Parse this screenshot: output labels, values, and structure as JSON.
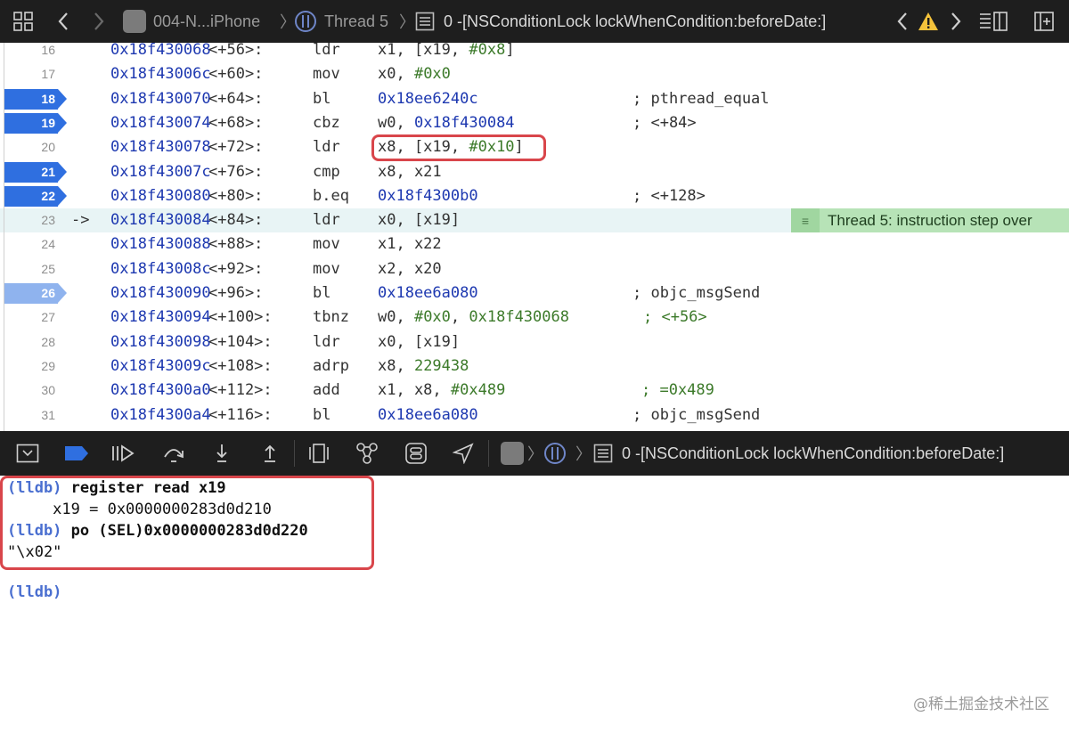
{
  "jump_bar": {
    "grid_icon": "grid-icon",
    "back": "chevron-left-icon",
    "forward": "chevron-right-icon",
    "scheme": "004-N...iPhone",
    "thread": "Thread 5",
    "frame": "0 -[NSConditionLock lockWhenCondition:beforeDate:]",
    "issue_prev": "chevron-left-icon",
    "warning": "warning-icon",
    "issue_next": "chevron-right-icon",
    "list_icon": "list-icon",
    "add_editor_icon": "add-editor-icon"
  },
  "code": {
    "lines": [
      {
        "n": "16",
        "addr": "0x18f430068",
        "off": "<+56>:",
        "mn": "ldr",
        "ops": [
          [
            "x1, [x19, ",
            ""
          ],
          [
            "#0x8",
            "imm"
          ],
          [
            "]",
            ""
          ]
        ],
        "comment": "",
        "bp": ""
      },
      {
        "n": "17",
        "addr": "0x18f43006c",
        "off": "<+60>:",
        "mn": "mov",
        "ops": [
          [
            "x0, ",
            ""
          ],
          [
            "#0x0",
            "imm"
          ]
        ],
        "comment": "",
        "bp": ""
      },
      {
        "n": "18",
        "addr": "0x18f430070",
        "off": "<+64>:",
        "mn": "bl",
        "ops": [
          [
            "0x18ee6240c",
            "sym"
          ]
        ],
        "comment": "; pthread_equal",
        "bp": "on"
      },
      {
        "n": "19",
        "addr": "0x18f430074",
        "off": "<+68>:",
        "mn": "cbz",
        "ops": [
          [
            "w0, ",
            ""
          ],
          [
            "0x18f430084",
            "sym"
          ]
        ],
        "comment": "; <+84>",
        "bp": "on"
      },
      {
        "n": "20",
        "addr": "0x18f430078",
        "off": "<+72>:",
        "mn": "ldr",
        "ops": [
          [
            "x8, [x19, ",
            ""
          ],
          [
            "#0x10",
            "imm"
          ],
          [
            "]",
            ""
          ]
        ],
        "comment": "",
        "bp": ""
      },
      {
        "n": "21",
        "addr": "0x18f43007c",
        "off": "<+76>:",
        "mn": "cmp",
        "ops": [
          [
            "x8, x21",
            ""
          ]
        ],
        "comment": "",
        "bp": "on"
      },
      {
        "n": "22",
        "addr": "0x18f430080",
        "off": "<+80>:",
        "mn": "b.eq",
        "ops": [
          [
            "0x18f4300b0",
            "sym"
          ]
        ],
        "comment": "; <+128>",
        "bp": "on"
      },
      {
        "n": "23",
        "addr": "0x18f430084",
        "off": "<+84>:",
        "mn": "ldr",
        "ops": [
          [
            "x0, [x19]",
            ""
          ]
        ],
        "comment": "",
        "bp": "",
        "arrow": "->",
        "current": true
      },
      {
        "n": "24",
        "addr": "0x18f430088",
        "off": "<+88>:",
        "mn": "mov",
        "ops": [
          [
            "x1, x22",
            ""
          ]
        ],
        "comment": "",
        "bp": ""
      },
      {
        "n": "25",
        "addr": "0x18f43008c",
        "off": "<+92>:",
        "mn": "mov",
        "ops": [
          [
            "x2, x20",
            ""
          ]
        ],
        "comment": "",
        "bp": ""
      },
      {
        "n": "26",
        "addr": "0x18f430090",
        "off": "<+96>:",
        "mn": "bl",
        "ops": [
          [
            "0x18ee6a080",
            "sym"
          ]
        ],
        "comment": "; objc_msgSend",
        "bp": "dim"
      },
      {
        "n": "27",
        "addr": "0x18f430094",
        "off": "<+100>:",
        "mn": "tbnz",
        "ops": [
          [
            "w0, ",
            ""
          ],
          [
            "#0x0",
            "imm"
          ],
          [
            ", ",
            ""
          ],
          [
            "0x18f430068",
            "imm"
          ]
        ],
        "comment": "; <+56>",
        "bp": "",
        "cgreen": true
      },
      {
        "n": "28",
        "addr": "0x18f430098",
        "off": "<+104>:",
        "mn": "ldr",
        "ops": [
          [
            "x0, [x19]",
            ""
          ]
        ],
        "comment": "",
        "bp": ""
      },
      {
        "n": "29",
        "addr": "0x18f43009c",
        "off": "<+108>:",
        "mn": "adrp",
        "ops": [
          [
            "x8, ",
            ""
          ],
          [
            "229438",
            "imm"
          ]
        ],
        "comment": "",
        "bp": ""
      },
      {
        "n": "30",
        "addr": "0x18f4300a0",
        "off": "<+112>:",
        "mn": "add",
        "ops": [
          [
            "x1, x8, ",
            ""
          ],
          [
            "#0x489",
            "imm"
          ]
        ],
        "comment": "; =0x489",
        "bp": "",
        "cgreen": true
      },
      {
        "n": "31",
        "addr": "0x18f4300a4",
        "off": "<+116>:",
        "mn": "bl",
        "ops": [
          [
            "0x18ee6a080",
            "sym"
          ]
        ],
        "comment": "; objc_msgSend",
        "bp": ""
      }
    ],
    "thread_badge": "Thread 5: instruction step over",
    "badge_icon": "menu-icon"
  },
  "debug_bar": {
    "frame": "0 -[NSConditionLock lockWhenCondition:beforeDate:]"
  },
  "console": {
    "l1_prompt": "(lldb)",
    "l1_cmd": " register read x19",
    "l2": "     x19 = 0x0000000283d0d210",
    "l3_prompt": "(lldb)",
    "l3_cmd": " po (SEL)0x0000000283d0d220",
    "l4": "\"\\x02\"",
    "l5_prompt": "(lldb)"
  },
  "watermark": "@稀土掘金技术社区",
  "colors": {
    "breakpoint": "#2f6fe0",
    "highlight": "#d9464b",
    "address": "#1d38b0",
    "immediate": "#3c7a2a"
  }
}
